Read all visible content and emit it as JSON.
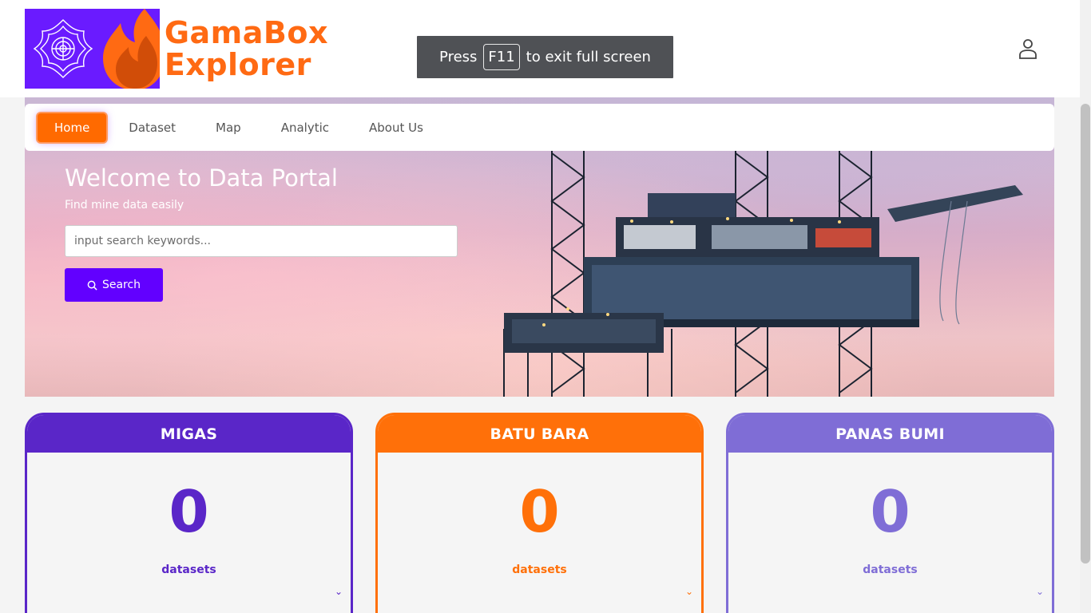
{
  "brand": {
    "line1": "GamaBox",
    "line2": "Explorer",
    "color_primary": "#ff6a13",
    "color_bg": "#6a1bff"
  },
  "toast": {
    "press": "Press",
    "key": "F11",
    "rest": "to exit full screen"
  },
  "nav": {
    "items": [
      {
        "label": "Home",
        "active": true
      },
      {
        "label": "Dataset"
      },
      {
        "label": "Map"
      },
      {
        "label": "Analytic"
      },
      {
        "label": "About Us"
      }
    ]
  },
  "hero": {
    "title": "Welcome to Data Portal",
    "subtitle": "Find mine data easily",
    "search_placeholder": "input search keywords...",
    "search_button": "Search"
  },
  "cards": [
    {
      "title": "MIGAS",
      "count": "0",
      "label": "datasets",
      "color": "#5a26c8"
    },
    {
      "title": "BATU BARA",
      "count": "0",
      "label": "datasets",
      "color": "#ff7009"
    },
    {
      "title": "PANAS BUMI",
      "count": "0",
      "label": "datasets",
      "color": "#7f6dd6"
    }
  ],
  "icons": {
    "user": "user-icon",
    "search": "search-icon",
    "chevron": "chevron-down-icon"
  }
}
